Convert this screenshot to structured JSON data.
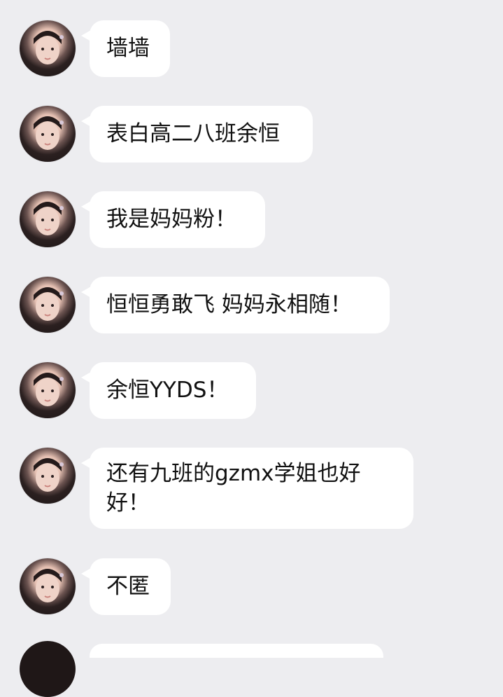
{
  "messages": [
    {
      "text": "墙墙"
    },
    {
      "text": "表白高二八班余恒"
    },
    {
      "text": "我是妈妈粉！"
    },
    {
      "text": "恒恒勇敢飞 妈妈永相随！"
    },
    {
      "text": "余恒YYDS！"
    },
    {
      "text": "还有九班的gzmx学姐也好\n好！"
    },
    {
      "text": "不匿"
    }
  ],
  "colors": {
    "background": "#ededf0",
    "bubble": "#ffffff",
    "text": "#111111"
  }
}
